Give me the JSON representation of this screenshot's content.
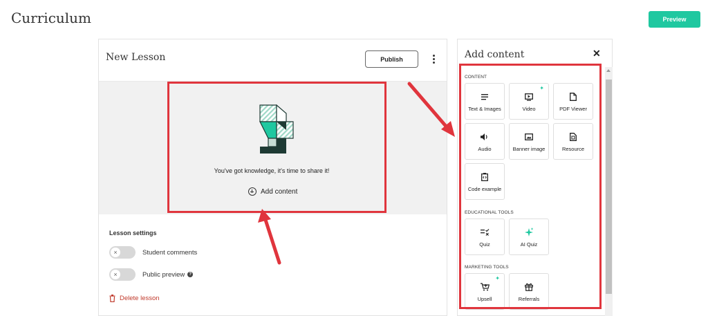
{
  "header": {
    "title": "Curriculum",
    "preview_label": "Preview"
  },
  "lesson": {
    "title": "New Lesson",
    "publish_label": "Publish",
    "empty_text": "You've got knowledge, it's time to share it!",
    "add_content_label": "Add content",
    "settings_title": "Lesson settings",
    "student_comments_label": "Student comments",
    "public_preview_label": "Public preview",
    "delete_label": "Delete lesson"
  },
  "panel": {
    "title": "Add content",
    "sections": {
      "content": "CONTENT",
      "educational": "EDUCATIONAL TOOLS",
      "marketing": "MARKETING TOOLS"
    },
    "tiles": {
      "text_images": "Text & Images",
      "video": "Video",
      "pdf_viewer": "PDF Viewer",
      "audio": "Audio",
      "banner_image": "Banner image",
      "resource": "Resource",
      "code_example": "Code example",
      "quiz": "Quiz",
      "ai_quiz": "AI Quiz",
      "upsell": "Upsell",
      "referrals": "Referrals"
    }
  },
  "colors": {
    "accent": "#1fc8a0",
    "annotation": "#e0353d",
    "danger": "#c0392b"
  }
}
